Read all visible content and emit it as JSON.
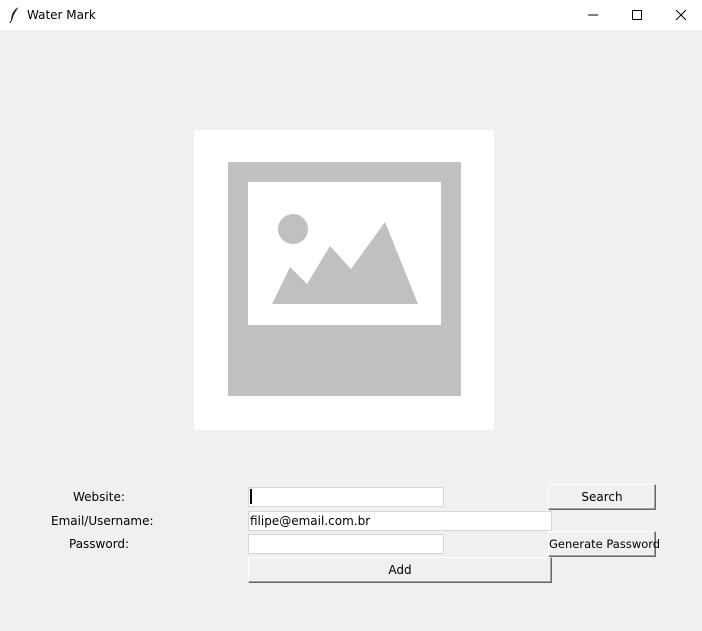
{
  "window": {
    "title": "Water Mark",
    "controls": {
      "minimize_icon": "minimize-icon",
      "maximize_icon": "maximize-icon",
      "close_icon": "close-icon"
    }
  },
  "canvas": {
    "image_icon": "image-placeholder-icon",
    "background": "#ffffff",
    "icon_color": "#c0c0c0"
  },
  "form": {
    "website_label": "Website:",
    "email_label": "Email/Username:",
    "password_label": "Password:",
    "website_value": "",
    "email_value": "filipe@email.com.br",
    "password_value": "",
    "search_label": "Search",
    "generate_password_label": "Generate Password",
    "add_label": "Add"
  },
  "colors": {
    "window_bg": "#f0f0f0",
    "titlebar_bg": "#ffffff"
  }
}
